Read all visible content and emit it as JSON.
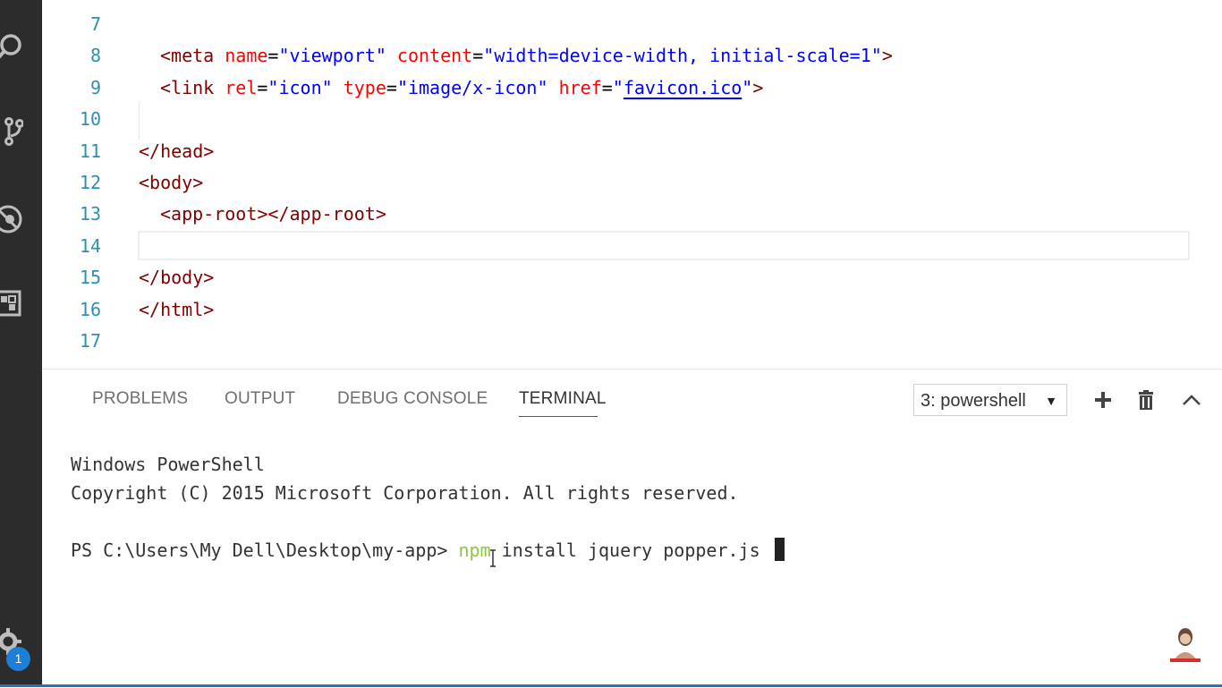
{
  "editor": {
    "lines": [
      {
        "num": "7",
        "parts": []
      },
      {
        "num": "8",
        "parts": [
          {
            "t": "<meta ",
            "c": "tag"
          },
          {
            "t": "name",
            "c": "attr"
          },
          {
            "t": "=",
            "c": "punc"
          },
          {
            "t": "\"viewport\"",
            "c": "val"
          },
          {
            "t": " ",
            "c": "punc"
          },
          {
            "t": "content",
            "c": "attr"
          },
          {
            "t": "=",
            "c": "punc"
          },
          {
            "t": "\"width=device-width, initial-scale=1\"",
            "c": "val"
          },
          {
            "t": ">",
            "c": "tag"
          }
        ]
      },
      {
        "num": "9",
        "parts": [
          {
            "t": "<link ",
            "c": "tag"
          },
          {
            "t": "rel",
            "c": "attr"
          },
          {
            "t": "=",
            "c": "punc"
          },
          {
            "t": "\"icon\"",
            "c": "val"
          },
          {
            "t": " ",
            "c": "punc"
          },
          {
            "t": "type",
            "c": "attr"
          },
          {
            "t": "=",
            "c": "punc"
          },
          {
            "t": "\"image/x-icon\"",
            "c": "val"
          },
          {
            "t": " ",
            "c": "punc"
          },
          {
            "t": "href",
            "c": "attr"
          },
          {
            "t": "=",
            "c": "punc"
          },
          {
            "t": "\"",
            "c": "val"
          },
          {
            "t": "favicon.ico",
            "c": "link"
          },
          {
            "t": "\"",
            "c": "val"
          },
          {
            "t": ">",
            "c": "tag"
          }
        ]
      },
      {
        "num": "10",
        "parts": []
      },
      {
        "num": "11",
        "parts": [
          {
            "t": "</head>",
            "c": "tag"
          }
        ]
      },
      {
        "num": "12",
        "parts": [
          {
            "t": "<body>",
            "c": "tag"
          }
        ]
      },
      {
        "num": "13",
        "parts": [
          {
            "t": "<app-root></app-root>",
            "c": "tag"
          }
        ]
      },
      {
        "num": "14",
        "parts": []
      },
      {
        "num": "15",
        "parts": [
          {
            "t": "</body>",
            "c": "tag"
          }
        ]
      },
      {
        "num": "16",
        "parts": [
          {
            "t": "</html>",
            "c": "tag"
          }
        ]
      },
      {
        "num": "17",
        "parts": []
      }
    ]
  },
  "panel": {
    "tabs": [
      "PROBLEMS",
      "OUTPUT",
      "DEBUG CONSOLE",
      "TERMINAL"
    ],
    "active_tab": "TERMINAL",
    "terminal_select": "3: powershell",
    "terminal_select_caret": "▼"
  },
  "terminal": {
    "line1": "Windows PowerShell",
    "line2": "Copyright (C) 2015 Microsoft Corporation. All rights reserved.",
    "prompt": "PS C:\\Users\\My Dell\\Desktop\\my-app> ",
    "command_npm": "npm",
    "command_rest": " install jquery popper.js "
  },
  "activity_bar": {
    "icons": [
      "search-icon",
      "source-control-icon",
      "debug-icon",
      "extensions-icon",
      "gear-icon"
    ],
    "badge": "1"
  },
  "colors": {
    "activity_bar": "#2c2c2c",
    "tag": "#800000",
    "attribute": "#ff0000",
    "value": "#0000ff",
    "line_number": "#2b91af",
    "npm": "#8dc63f",
    "badge": "#1e7fd6"
  }
}
